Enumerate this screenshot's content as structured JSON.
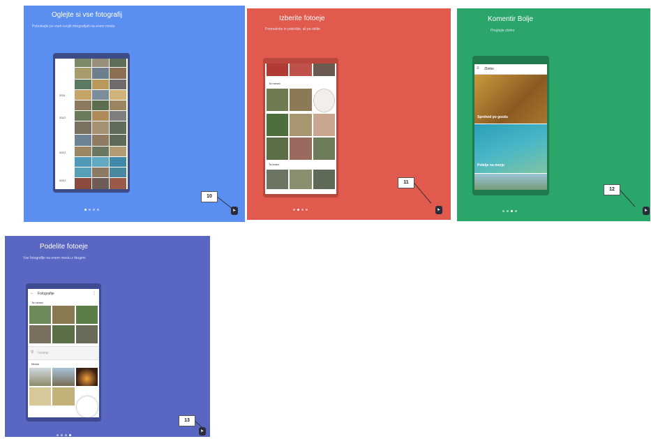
{
  "panels": [
    {
      "title": "Oglejte si vse fotografij",
      "subtitle": "Pobrskajte po vseh svojih fotografijah na enem mestu",
      "step": "10"
    },
    {
      "title": "Izberite fotoeje",
      "subtitle": "Premaknite in pobrišite, ali pa delite",
      "step": "11"
    },
    {
      "title": "Komentir Bolje",
      "subtitle": "Preglejte zbirko",
      "step": "12"
    },
    {
      "title": "Podelite fotoeje",
      "subtitle": "Vse fotografije na enem mestu z drugimi",
      "step": "13"
    }
  ],
  "phone2": {
    "section1": "Ta mesec",
    "section2": "Ta teden"
  },
  "phone3": {
    "header": "Zbirke",
    "caption1": "Sprehod po gozdu",
    "caption2": "Poletje na morju"
  },
  "phone4": {
    "header": "Fotografije",
    "section": "Ta mesec",
    "search": "Iskanje",
    "group": "Mesta"
  },
  "phone1": {
    "years": [
      "2011",
      "2012",
      "2013",
      "2014"
    ]
  },
  "colors": {
    "blue": "#5b8ef1",
    "red": "#e05a4e",
    "green": "#2aa66a",
    "indigo": "#5967c3"
  }
}
